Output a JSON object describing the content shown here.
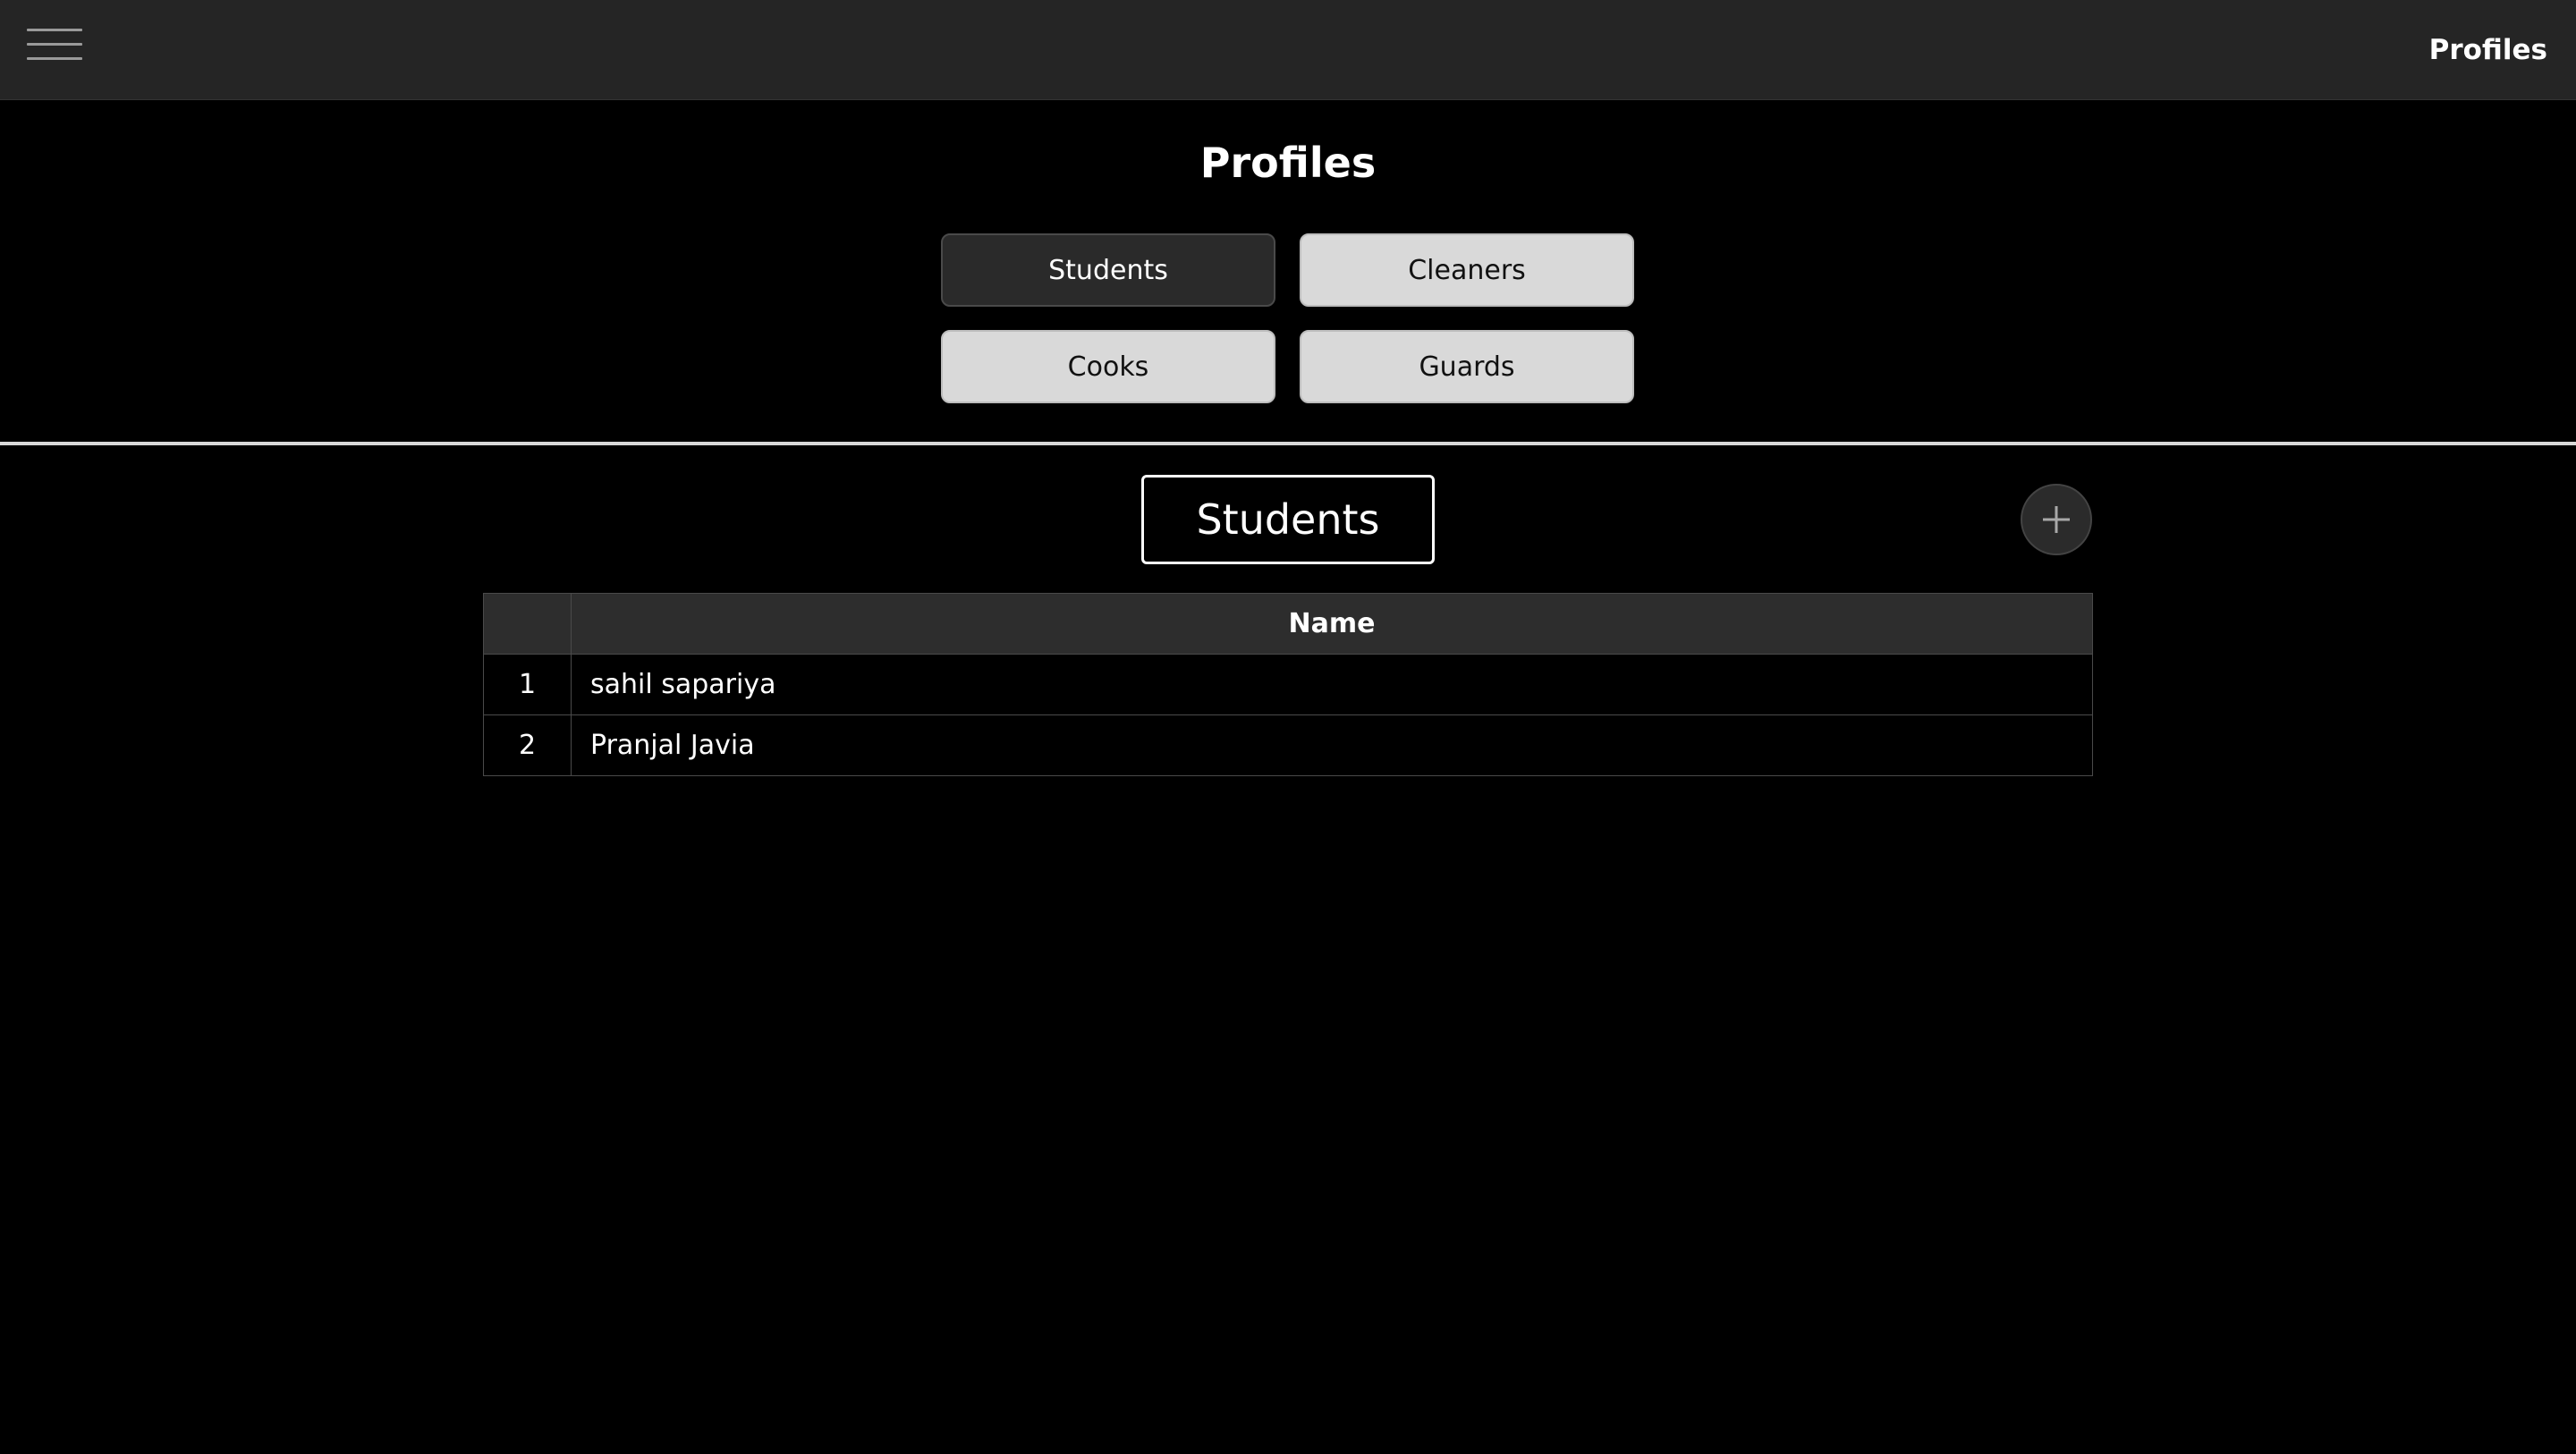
{
  "topbar": {
    "menu_icon": "hamburger-menu-icon",
    "title": "Profiles"
  },
  "page": {
    "title": "Profiles"
  },
  "categories": [
    {
      "label": "Students",
      "active": true
    },
    {
      "label": "Cleaners",
      "active": false
    },
    {
      "label": "Cooks",
      "active": false
    },
    {
      "label": "Guards",
      "active": false
    }
  ],
  "section": {
    "title": "Students",
    "add_icon": "plus-icon"
  },
  "table": {
    "columns": [
      "",
      "Name"
    ],
    "rows": [
      {
        "index": "1",
        "name": "sahil sapariya"
      },
      {
        "index": "2",
        "name": "Pranjal Javia"
      }
    ]
  },
  "colors": {
    "background": "#000000",
    "topbar": "#252525",
    "active_button": "#2a2a2a",
    "inactive_button": "#d9d9d9",
    "table_header": "#2d2d2d"
  }
}
